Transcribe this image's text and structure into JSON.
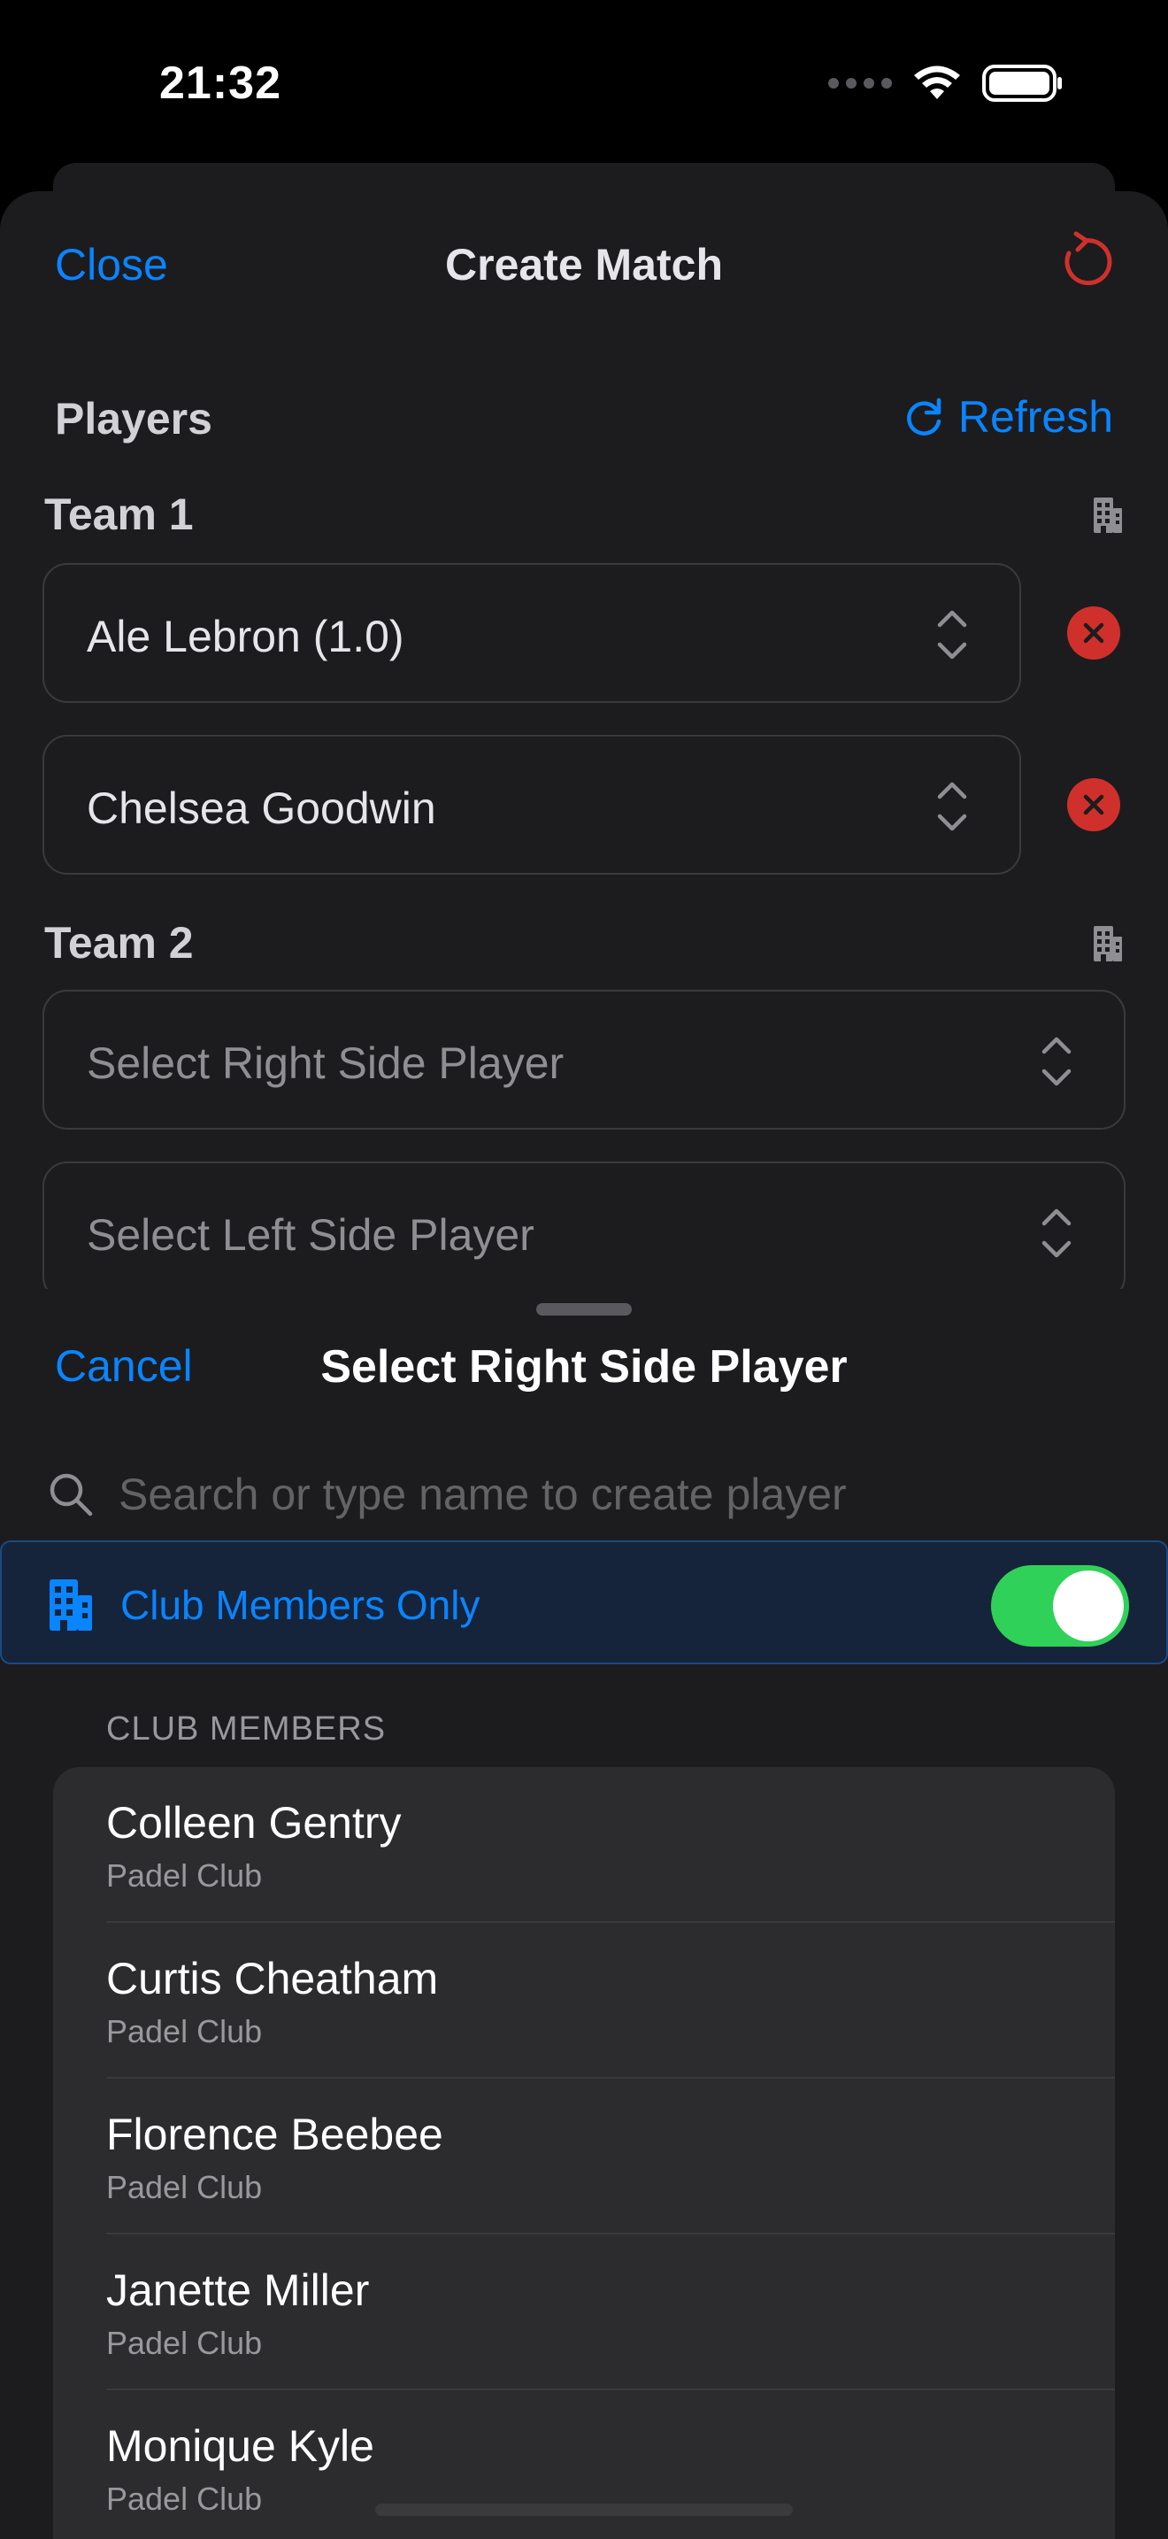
{
  "status_bar": {
    "time": "21:32"
  },
  "create_match": {
    "close_label": "Close",
    "title": "Create Match",
    "players_header": "Players",
    "refresh_label": "Refresh",
    "team1": {
      "label": "Team 1",
      "players": [
        "Ale Lebron (1.0)",
        "Chelsea Goodwin"
      ]
    },
    "team2": {
      "label": "Team 2",
      "right_placeholder": "Select Right Side Player",
      "left_placeholder": "Select Left Side Player"
    }
  },
  "select_sheet": {
    "cancel_label": "Cancel",
    "title": "Select Right Side Player",
    "search_placeholder": "Search or type name to create player",
    "club_toggle_label": "Club Members Only",
    "club_toggle_on": true,
    "section_header": "CLUB MEMBERS",
    "members": [
      {
        "name": "Colleen Gentry",
        "club": "Padel Club"
      },
      {
        "name": "Curtis Cheatham",
        "club": "Padel Club"
      },
      {
        "name": "Florence Beebee",
        "club": "Padel Club"
      },
      {
        "name": "Janette Miller",
        "club": "Padel Club"
      },
      {
        "name": "Monique Kyle",
        "club": "Padel Club"
      }
    ]
  },
  "colors": {
    "accent": "#0a84ff",
    "destructive": "#d0302c",
    "toggle_on": "#30d158",
    "background": "#1c1c1e"
  },
  "icons": [
    "reset-icon",
    "refresh-icon",
    "building-icon",
    "chevron-up-down-icon",
    "remove-icon",
    "search-icon",
    "wifi-icon",
    "battery-icon"
  ]
}
